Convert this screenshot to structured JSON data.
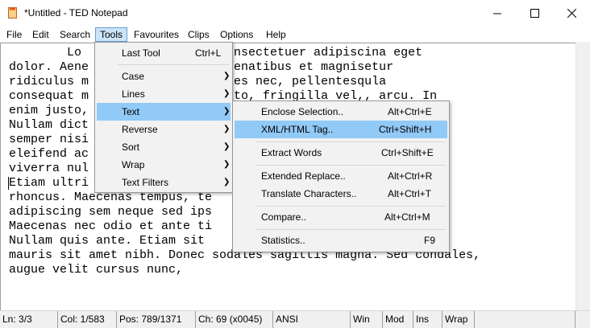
{
  "window": {
    "title": "*Untitled - TED Notepad"
  },
  "menubar": {
    "items": [
      {
        "label": "File"
      },
      {
        "label": "Edit"
      },
      {
        "label": "Search"
      },
      {
        "label": "Tools"
      },
      {
        "label": "Favourites"
      },
      {
        "label": "Clips"
      },
      {
        "label": "Options"
      },
      {
        "label": "Help"
      }
    ]
  },
  "editor": {
    "lines": [
      "        Lo          it amet, consectetuer adipiscina eget",
      "dolor. Aene        is natoque penatibus et magnisetur",
      "ridiculus m        lis, ultricies nec, pellentesqula",
      "consequat m       onec pede justo, fringilla vel,, arcu. In",
      "enim justo,                                  ustc",
      "Nullam dict                                  ciduementum",
      "semper nisi                                  oo lat vitae,",
      "eleifend ac                                  erra asellus",
      "viverra nul                                  Aene",
      "Etiam ultri                                  ultriam",
      "rhoncus. Maecenas tempus, te                 us, amet",
      "adipiscing sem neque sed ips                 vel,id, lorem.",
      "Maecenas nec odio et ante ti                 e sapibus.",
      "Nullam quis ante. Etiam sit                  s tiilla",
      "mauris sit amet nibh. Donec sodales sagittis magna. Sed condales,",
      "augue velit cursus nunc,"
    ]
  },
  "tools_menu": {
    "items": [
      {
        "label": "Last Tool",
        "shortcut": "Ctrl+L"
      },
      {
        "label": "Case"
      },
      {
        "label": "Lines"
      },
      {
        "label": "Text"
      },
      {
        "label": "Reverse"
      },
      {
        "label": "Sort"
      },
      {
        "label": "Wrap"
      },
      {
        "label": "Text Filters"
      }
    ]
  },
  "text_submenu": {
    "items": [
      {
        "label": "Enclose Selection..",
        "shortcut": "Alt+Ctrl+E"
      },
      {
        "label": "XML/HTML Tag..",
        "shortcut": "Ctrl+Shift+H"
      },
      {
        "label": "Extract Words",
        "shortcut": "Ctrl+Shift+E"
      },
      {
        "label": "Extended Replace..",
        "shortcut": "Alt+Ctrl+R"
      },
      {
        "label": "Translate Characters..",
        "shortcut": "Alt+Ctrl+T"
      },
      {
        "label": "Compare..",
        "shortcut": "Alt+Ctrl+M"
      },
      {
        "label": "Statistics..",
        "shortcut": "F9"
      }
    ]
  },
  "statusbar": {
    "ln": "Ln: 3/3",
    "col": "Col: 1/583",
    "pos": "Pos: 789/1371",
    "ch": "Ch: 69 (x0045)",
    "encoding": "ANSI",
    "eol": "Win",
    "mod": "Mod",
    "ins": "Ins",
    "wrap": "Wrap"
  },
  "colors": {
    "highlight": "#91c9f7",
    "menu_active": "#cce4f7"
  }
}
